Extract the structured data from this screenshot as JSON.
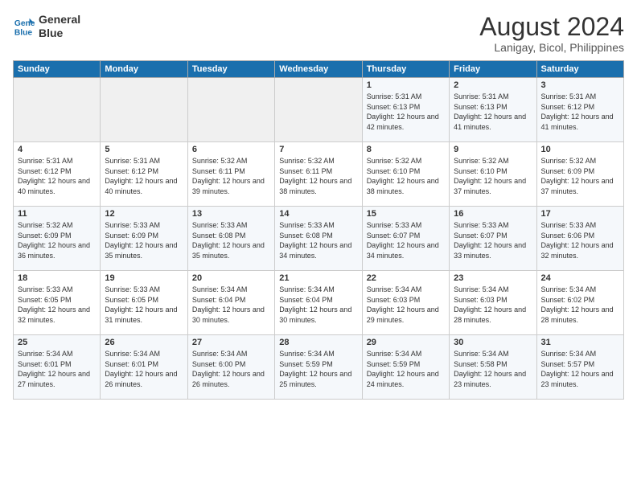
{
  "logo": {
    "line1": "General",
    "line2": "Blue"
  },
  "title": "August 2024",
  "subtitle": "Lanigay, Bicol, Philippines",
  "days_of_week": [
    "Sunday",
    "Monday",
    "Tuesday",
    "Wednesday",
    "Thursday",
    "Friday",
    "Saturday"
  ],
  "weeks": [
    [
      {
        "day": "",
        "content": ""
      },
      {
        "day": "",
        "content": ""
      },
      {
        "day": "",
        "content": ""
      },
      {
        "day": "",
        "content": ""
      },
      {
        "day": "1",
        "content": "Sunrise: 5:31 AM\nSunset: 6:13 PM\nDaylight: 12 hours\nand 42 minutes."
      },
      {
        "day": "2",
        "content": "Sunrise: 5:31 AM\nSunset: 6:13 PM\nDaylight: 12 hours\nand 41 minutes."
      },
      {
        "day": "3",
        "content": "Sunrise: 5:31 AM\nSunset: 6:12 PM\nDaylight: 12 hours\nand 41 minutes."
      }
    ],
    [
      {
        "day": "4",
        "content": "Sunrise: 5:31 AM\nSunset: 6:12 PM\nDaylight: 12 hours\nand 40 minutes."
      },
      {
        "day": "5",
        "content": "Sunrise: 5:31 AM\nSunset: 6:12 PM\nDaylight: 12 hours\nand 40 minutes."
      },
      {
        "day": "6",
        "content": "Sunrise: 5:32 AM\nSunset: 6:11 PM\nDaylight: 12 hours\nand 39 minutes."
      },
      {
        "day": "7",
        "content": "Sunrise: 5:32 AM\nSunset: 6:11 PM\nDaylight: 12 hours\nand 38 minutes."
      },
      {
        "day": "8",
        "content": "Sunrise: 5:32 AM\nSunset: 6:10 PM\nDaylight: 12 hours\nand 38 minutes."
      },
      {
        "day": "9",
        "content": "Sunrise: 5:32 AM\nSunset: 6:10 PM\nDaylight: 12 hours\nand 37 minutes."
      },
      {
        "day": "10",
        "content": "Sunrise: 5:32 AM\nSunset: 6:09 PM\nDaylight: 12 hours\nand 37 minutes."
      }
    ],
    [
      {
        "day": "11",
        "content": "Sunrise: 5:32 AM\nSunset: 6:09 PM\nDaylight: 12 hours\nand 36 minutes."
      },
      {
        "day": "12",
        "content": "Sunrise: 5:33 AM\nSunset: 6:09 PM\nDaylight: 12 hours\nand 35 minutes."
      },
      {
        "day": "13",
        "content": "Sunrise: 5:33 AM\nSunset: 6:08 PM\nDaylight: 12 hours\nand 35 minutes."
      },
      {
        "day": "14",
        "content": "Sunrise: 5:33 AM\nSunset: 6:08 PM\nDaylight: 12 hours\nand 34 minutes."
      },
      {
        "day": "15",
        "content": "Sunrise: 5:33 AM\nSunset: 6:07 PM\nDaylight: 12 hours\nand 34 minutes."
      },
      {
        "day": "16",
        "content": "Sunrise: 5:33 AM\nSunset: 6:07 PM\nDaylight: 12 hours\nand 33 minutes."
      },
      {
        "day": "17",
        "content": "Sunrise: 5:33 AM\nSunset: 6:06 PM\nDaylight: 12 hours\nand 32 minutes."
      }
    ],
    [
      {
        "day": "18",
        "content": "Sunrise: 5:33 AM\nSunset: 6:05 PM\nDaylight: 12 hours\nand 32 minutes."
      },
      {
        "day": "19",
        "content": "Sunrise: 5:33 AM\nSunset: 6:05 PM\nDaylight: 12 hours\nand 31 minutes."
      },
      {
        "day": "20",
        "content": "Sunrise: 5:34 AM\nSunset: 6:04 PM\nDaylight: 12 hours\nand 30 minutes."
      },
      {
        "day": "21",
        "content": "Sunrise: 5:34 AM\nSunset: 6:04 PM\nDaylight: 12 hours\nand 30 minutes."
      },
      {
        "day": "22",
        "content": "Sunrise: 5:34 AM\nSunset: 6:03 PM\nDaylight: 12 hours\nand 29 minutes."
      },
      {
        "day": "23",
        "content": "Sunrise: 5:34 AM\nSunset: 6:03 PM\nDaylight: 12 hours\nand 28 minutes."
      },
      {
        "day": "24",
        "content": "Sunrise: 5:34 AM\nSunset: 6:02 PM\nDaylight: 12 hours\nand 28 minutes."
      }
    ],
    [
      {
        "day": "25",
        "content": "Sunrise: 5:34 AM\nSunset: 6:01 PM\nDaylight: 12 hours\nand 27 minutes."
      },
      {
        "day": "26",
        "content": "Sunrise: 5:34 AM\nSunset: 6:01 PM\nDaylight: 12 hours\nand 26 minutes."
      },
      {
        "day": "27",
        "content": "Sunrise: 5:34 AM\nSunset: 6:00 PM\nDaylight: 12 hours\nand 26 minutes."
      },
      {
        "day": "28",
        "content": "Sunrise: 5:34 AM\nSunset: 5:59 PM\nDaylight: 12 hours\nand 25 minutes."
      },
      {
        "day": "29",
        "content": "Sunrise: 5:34 AM\nSunset: 5:59 PM\nDaylight: 12 hours\nand 24 minutes."
      },
      {
        "day": "30",
        "content": "Sunrise: 5:34 AM\nSunset: 5:58 PM\nDaylight: 12 hours\nand 23 minutes."
      },
      {
        "day": "31",
        "content": "Sunrise: 5:34 AM\nSunset: 5:57 PM\nDaylight: 12 hours\nand 23 minutes."
      }
    ]
  ]
}
